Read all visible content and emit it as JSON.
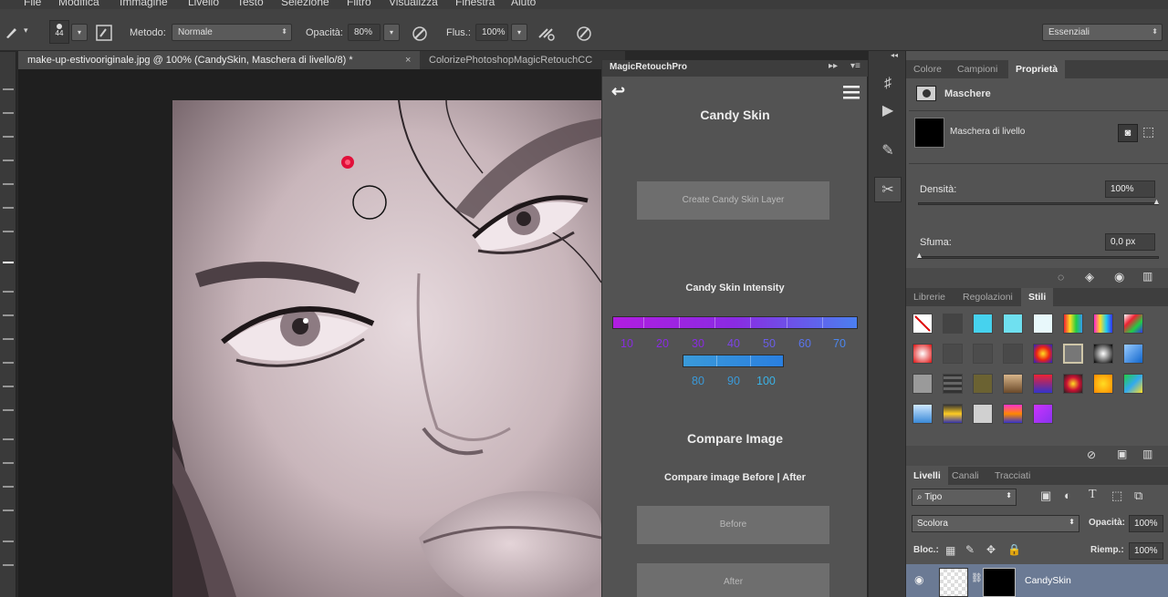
{
  "menu": [
    "File",
    "Modifica",
    "Immagine",
    "Livello",
    "Testo",
    "Selezione",
    "Filtro",
    "Visualizza",
    "Finestra",
    "Aiuto"
  ],
  "options": {
    "brush_size": "44",
    "metodo_label": "Metodo:",
    "metodo_value": "Normale",
    "opacita_label": "Opacità:",
    "opacita_value": "80%",
    "flusso_label": "Flus.:",
    "flusso_value": "100%",
    "workspace": "Essenziali"
  },
  "doc_tabs": [
    {
      "label": "make-up-estivooriginale.jpg @ 100% (CandySkin, Maschera di livello/8) *",
      "close": "×"
    },
    {
      "label": "ColorizePhotoshopMagicRetouchCC"
    }
  ],
  "plugin": {
    "title": "MagicRetouchPro",
    "back_icon": "↩",
    "menu_icon": "hamburger-icon",
    "heading": "Candy Skin",
    "create_button": "Create Candy Skin Layer",
    "intensity_label": "Candy Skin Intensity",
    "intensity_row1": [
      "10",
      "20",
      "30",
      "40",
      "50",
      "60",
      "70"
    ],
    "intensity_row2": [
      "80",
      "90",
      "100"
    ],
    "compare_heading": "Compare Image",
    "compare_sub": "Compare image Before | After",
    "before_button": "Before",
    "after_button": "After",
    "row1_color": "#8a2be2",
    "row2_color": "#3a9ad9"
  },
  "properties": {
    "tabs": [
      "Colore",
      "Campioni",
      "Proprietà"
    ],
    "section": "Maschere",
    "mask_label": "Maschera di livello",
    "densita_label": "Densità:",
    "densita_value": "100%",
    "sfuma_label": "Sfuma:",
    "sfuma_value": "0,0 px"
  },
  "styles": {
    "tabs": [
      "Librerie",
      "Regolazioni",
      "Stili"
    ]
  },
  "layers": {
    "tabs": [
      "Livelli",
      "Canali",
      "Tracciati"
    ],
    "filter_value": "Tipo",
    "blend_mode": "Scolora",
    "opacita_label": "Opacità:",
    "opacita_value": "100%",
    "blocca_label": "Bloc.:",
    "riemp_label": "Riemp.:",
    "riemp_value": "100%",
    "layer_name": "CandySkin"
  }
}
